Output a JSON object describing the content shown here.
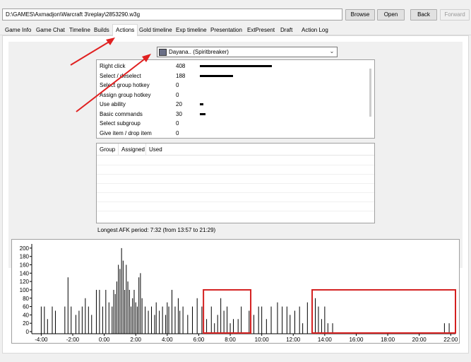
{
  "path": {
    "value": "D:\\GAMES\\Axmadjon\\Warcraft 3\\replay\\2853290.w3g"
  },
  "buttons": {
    "browse": "Browse",
    "open": "Open",
    "back": "Back",
    "forward": "Forward"
  },
  "tabs": [
    {
      "label": "Game Info"
    },
    {
      "label": "Game Chat"
    },
    {
      "label": "Timeline"
    },
    {
      "label": "Builds"
    },
    {
      "label": "Actions",
      "active": true
    },
    {
      "label": "Gold timeline"
    },
    {
      "label": "Exp timeline"
    },
    {
      "label": "Presentation"
    },
    {
      "label": "ExtPresent"
    },
    {
      "label": "Draft"
    },
    {
      "label": "Action Log"
    }
  ],
  "player_select": {
    "value": "Dayana.. (Spiritbreaker)"
  },
  "actions": [
    {
      "label": "Right click",
      "count": "408",
      "value": 408
    },
    {
      "label": "Select / deselect",
      "count": "188",
      "value": 188
    },
    {
      "label": "Select group hotkey",
      "count": "0",
      "value": 0
    },
    {
      "label": "Assign group hotkey",
      "count": "0",
      "value": 0
    },
    {
      "label": "Use ability",
      "count": "20",
      "value": 20
    },
    {
      "label": "Basic commands",
      "count": "30",
      "value": 30
    },
    {
      "label": "Select subgroup",
      "count": "0",
      "value": 0
    },
    {
      "label": "Give item / drop item",
      "count": "0",
      "value": 0
    }
  ],
  "group_table": {
    "columns": [
      "Group",
      "Assigned",
      "Used"
    ]
  },
  "afk_text": "Longest AFK period: 7:32 (from 13:57 to 21:29)",
  "colors": {
    "annotation_red": "#e02020",
    "bar": "#000000",
    "highlight_box": "#d42020"
  },
  "chart_data": {
    "type": "bar",
    "title": "",
    "xlabel": "",
    "ylabel": "",
    "ylim": [
      0,
      210
    ],
    "xlim_minutes": [
      -4.6,
      22.3
    ],
    "y_ticks": [
      "0",
      "20",
      "40",
      "60",
      "80",
      "100",
      "120",
      "140",
      "160",
      "180",
      "200"
    ],
    "x_ticks": [
      {
        "label": "-4:00",
        "minute": -4
      },
      {
        "label": "-2:00",
        "minute": -2
      },
      {
        "label": "0:00",
        "minute": 0
      },
      {
        "label": "2:00",
        "minute": 2
      },
      {
        "label": "4:00",
        "minute": 4
      },
      {
        "label": "6:00",
        "minute": 6
      },
      {
        "label": "8:00",
        "minute": 8
      },
      {
        "label": "10:00",
        "minute": 10
      },
      {
        "label": "12:00",
        "minute": 12
      },
      {
        "label": "14:00",
        "minute": 14
      },
      {
        "label": "16:00",
        "minute": 16
      },
      {
        "label": "18:00",
        "minute": 18
      },
      {
        "label": "20:00",
        "minute": 20
      },
      {
        "label": "22:00",
        "minute": 22
      }
    ],
    "bars": [
      [
        -4.0,
        60
      ],
      [
        -3.8,
        60
      ],
      [
        -3.6,
        30
      ],
      [
        -3.3,
        60
      ],
      [
        -3.1,
        50
      ],
      [
        -2.5,
        60
      ],
      [
        -2.3,
        130
      ],
      [
        -2.1,
        60
      ],
      [
        -1.8,
        40
      ],
      [
        -1.6,
        50
      ],
      [
        -1.4,
        60
      ],
      [
        -1.2,
        80
      ],
      [
        -1.0,
        60
      ],
      [
        -0.8,
        40
      ],
      [
        -0.5,
        100
      ],
      [
        -0.3,
        100
      ],
      [
        -0.1,
        60
      ],
      [
        0.1,
        100
      ],
      [
        0.3,
        70
      ],
      [
        0.5,
        60
      ],
      [
        0.6,
        100
      ],
      [
        0.7,
        90
      ],
      [
        0.8,
        120
      ],
      [
        0.9,
        160
      ],
      [
        1.0,
        150
      ],
      [
        1.1,
        200
      ],
      [
        1.2,
        170
      ],
      [
        1.3,
        100
      ],
      [
        1.4,
        160
      ],
      [
        1.5,
        120
      ],
      [
        1.6,
        100
      ],
      [
        1.7,
        60
      ],
      [
        1.8,
        80
      ],
      [
        1.9,
        100
      ],
      [
        2.0,
        70
      ],
      [
        2.1,
        60
      ],
      [
        2.2,
        130
      ],
      [
        2.3,
        140
      ],
      [
        2.4,
        80
      ],
      [
        2.6,
        60
      ],
      [
        2.8,
        50
      ],
      [
        3.0,
        60
      ],
      [
        3.2,
        40
      ],
      [
        3.3,
        70
      ],
      [
        3.5,
        50
      ],
      [
        3.7,
        60
      ],
      [
        3.9,
        40
      ],
      [
        4.0,
        70
      ],
      [
        4.1,
        60
      ],
      [
        4.3,
        100
      ],
      [
        4.5,
        60
      ],
      [
        4.7,
        80
      ],
      [
        4.8,
        50
      ],
      [
        5.0,
        60
      ],
      [
        5.3,
        40
      ],
      [
        5.6,
        60
      ],
      [
        5.9,
        80
      ],
      [
        6.2,
        60
      ],
      [
        6.5,
        30
      ],
      [
        6.8,
        60
      ],
      [
        7.0,
        20
      ],
      [
        7.2,
        40
      ],
      [
        7.4,
        80
      ],
      [
        7.6,
        50
      ],
      [
        7.8,
        60
      ],
      [
        8.0,
        20
      ],
      [
        8.2,
        30
      ],
      [
        8.5,
        30
      ],
      [
        8.7,
        60
      ],
      [
        9.2,
        50
      ],
      [
        9.5,
        40
      ],
      [
        9.8,
        60
      ],
      [
        10.0,
        60
      ],
      [
        10.3,
        30
      ],
      [
        10.6,
        60
      ],
      [
        11.0,
        70
      ],
      [
        11.3,
        60
      ],
      [
        11.6,
        60
      ],
      [
        11.8,
        40
      ],
      [
        12.1,
        50
      ],
      [
        12.4,
        60
      ],
      [
        12.6,
        20
      ],
      [
        12.9,
        70
      ],
      [
        13.2,
        100
      ],
      [
        13.4,
        80
      ],
      [
        13.6,
        60
      ],
      [
        13.8,
        30
      ],
      [
        14.0,
        60
      ],
      [
        14.2,
        20
      ],
      [
        14.5,
        20
      ],
      [
        21.6,
        20
      ],
      [
        21.9,
        20
      ]
    ],
    "highlight_boxes": [
      {
        "x_start_minute": 6.3,
        "x_end_minute": 9.3
      },
      {
        "x_start_minute": 13.2,
        "x_end_minute": 22.3
      }
    ]
  }
}
